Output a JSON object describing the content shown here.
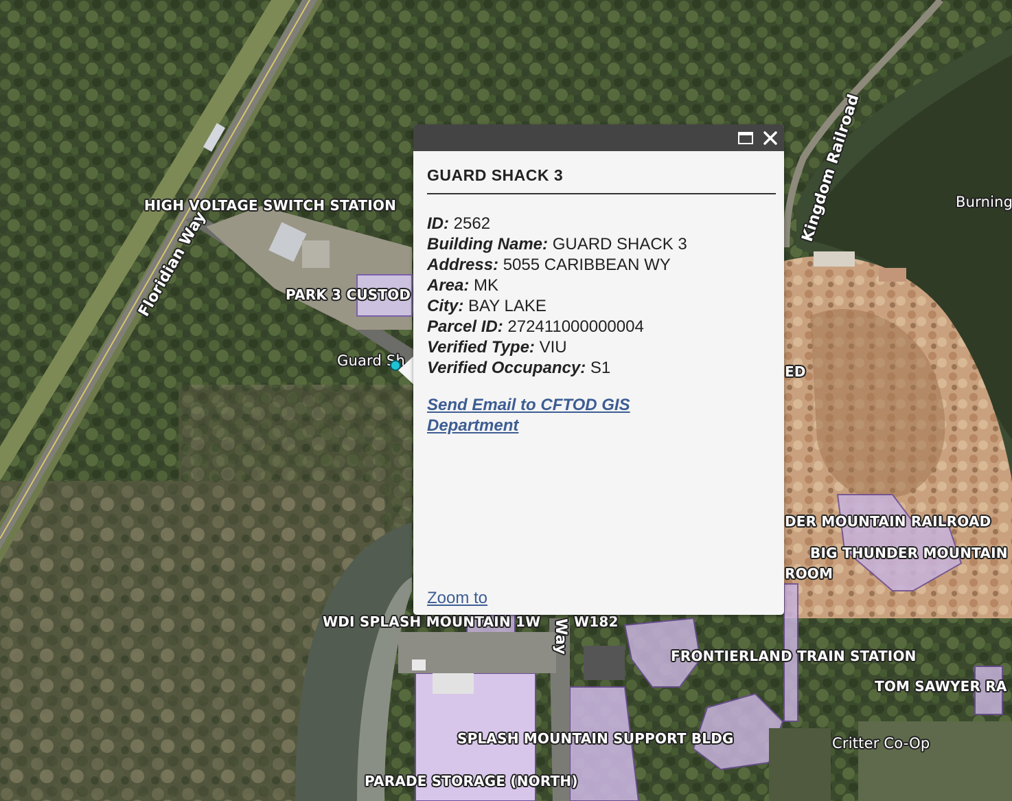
{
  "map": {
    "labels": {
      "high_voltage": "HIGH VOLTAGE SWITCH STATION",
      "floridian_way": "Floridian Way",
      "park3_custod": "PARK 3 CUSTOD",
      "guard_shack": "Guard Sh",
      "kingdom_railroad": "Kingdom Railroad",
      "burning": "Burning",
      "ed": "ED",
      "thunder_railroad": "DER MOUNTAIN RAILROAD",
      "big_thunder": "BIG THUNDER MOUNTAIN",
      "room": "ROOM",
      "wdi_splash": "WDI SPLASH MOUNTAIN 1W",
      "w182": "W182",
      "way": "Way",
      "frontierland": "FRONTIERLAND TRAIN STATION",
      "tom_sawyer": "TOM SAWYER RA",
      "splash_support": "SPLASH MOUNTAIN SUPPORT BLDG",
      "critter": "Critter Co-Op",
      "parade_storage": "PARADE STORAGE (NORTH)"
    }
  },
  "popup": {
    "title": "GUARD SHACK 3",
    "attributes": [
      {
        "key": "ID:",
        "value": "2562"
      },
      {
        "key": "Building Name:",
        "value": "GUARD SHACK 3"
      },
      {
        "key": "Address:",
        "value": "5055 CARIBBEAN WY"
      },
      {
        "key": "Area:",
        "value": "MK"
      },
      {
        "key": "City:",
        "value": "BAY LAKE"
      },
      {
        "key": "Parcel ID:",
        "value": "272411000000004"
      },
      {
        "key": "Verified Type:",
        "value": "VIU"
      },
      {
        "key": "Verified Occupancy:",
        "value": "S1"
      }
    ],
    "email_link": "Send Email to CFTOD GIS Department",
    "zoom_link": "Zoom to",
    "icons": {
      "maximize": "maximize-icon",
      "close": "close-icon"
    }
  }
}
